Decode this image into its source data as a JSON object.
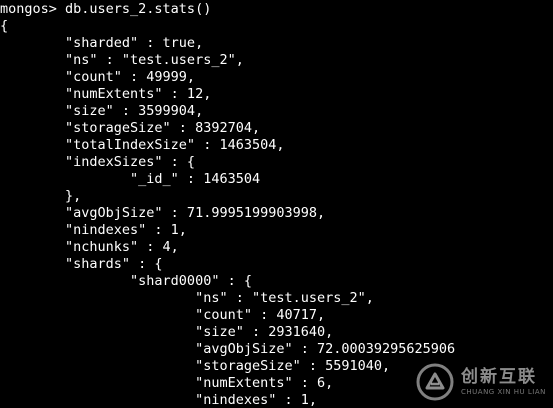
{
  "terminal": {
    "lines": [
      "mongos> db.users_2.stats()",
      "{",
      "        \"sharded\" : true,",
      "        \"ns\" : \"test.users_2\",",
      "        \"count\" : 49999,",
      "        \"numExtents\" : 12,",
      "        \"size\" : 3599904,",
      "        \"storageSize\" : 8392704,",
      "        \"totalIndexSize\" : 1463504,",
      "        \"indexSizes\" : {",
      "                \"_id_\" : 1463504",
      "        },",
      "        \"avgObjSize\" : 71.9995199903998,",
      "        \"nindexes\" : 1,",
      "        \"nchunks\" : 4,",
      "        \"shards\" : {",
      "                \"shard0000\" : {",
      "                        \"ns\" : \"test.users_2\",",
      "                        \"count\" : 40717,",
      "                        \"size\" : 2931640,",
      "                        \"avgObjSize\" : 72.00039295625906",
      "                        \"storageSize\" : 5591040,",
      "                        \"numExtents\" : 6,",
      "                        \"nindexes\" : 1,"
    ]
  },
  "watermark": {
    "chinese": "创新互联",
    "english": "CHUANG XIN HU LIAN",
    "icon": "chuangxin-logo-icon"
  }
}
